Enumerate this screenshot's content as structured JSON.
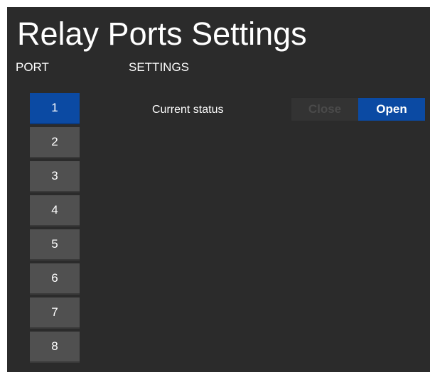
{
  "page": {
    "title": "Relay Ports Settings"
  },
  "headers": {
    "port": "PORT",
    "settings": "SETTINGS"
  },
  "ports": [
    {
      "label": "1",
      "selected": true
    },
    {
      "label": "2",
      "selected": false
    },
    {
      "label": "3",
      "selected": false
    },
    {
      "label": "4",
      "selected": false
    },
    {
      "label": "5",
      "selected": false
    },
    {
      "label": "6",
      "selected": false
    },
    {
      "label": "7",
      "selected": false
    },
    {
      "label": "8",
      "selected": false
    }
  ],
  "settings": {
    "current_status_label": "Current status",
    "toggle": {
      "close_label": "Close",
      "open_label": "Open",
      "selected": "Open"
    }
  },
  "colors": {
    "background": "#2b2b2b",
    "accent": "#0b4aa3",
    "button": "#505050"
  }
}
